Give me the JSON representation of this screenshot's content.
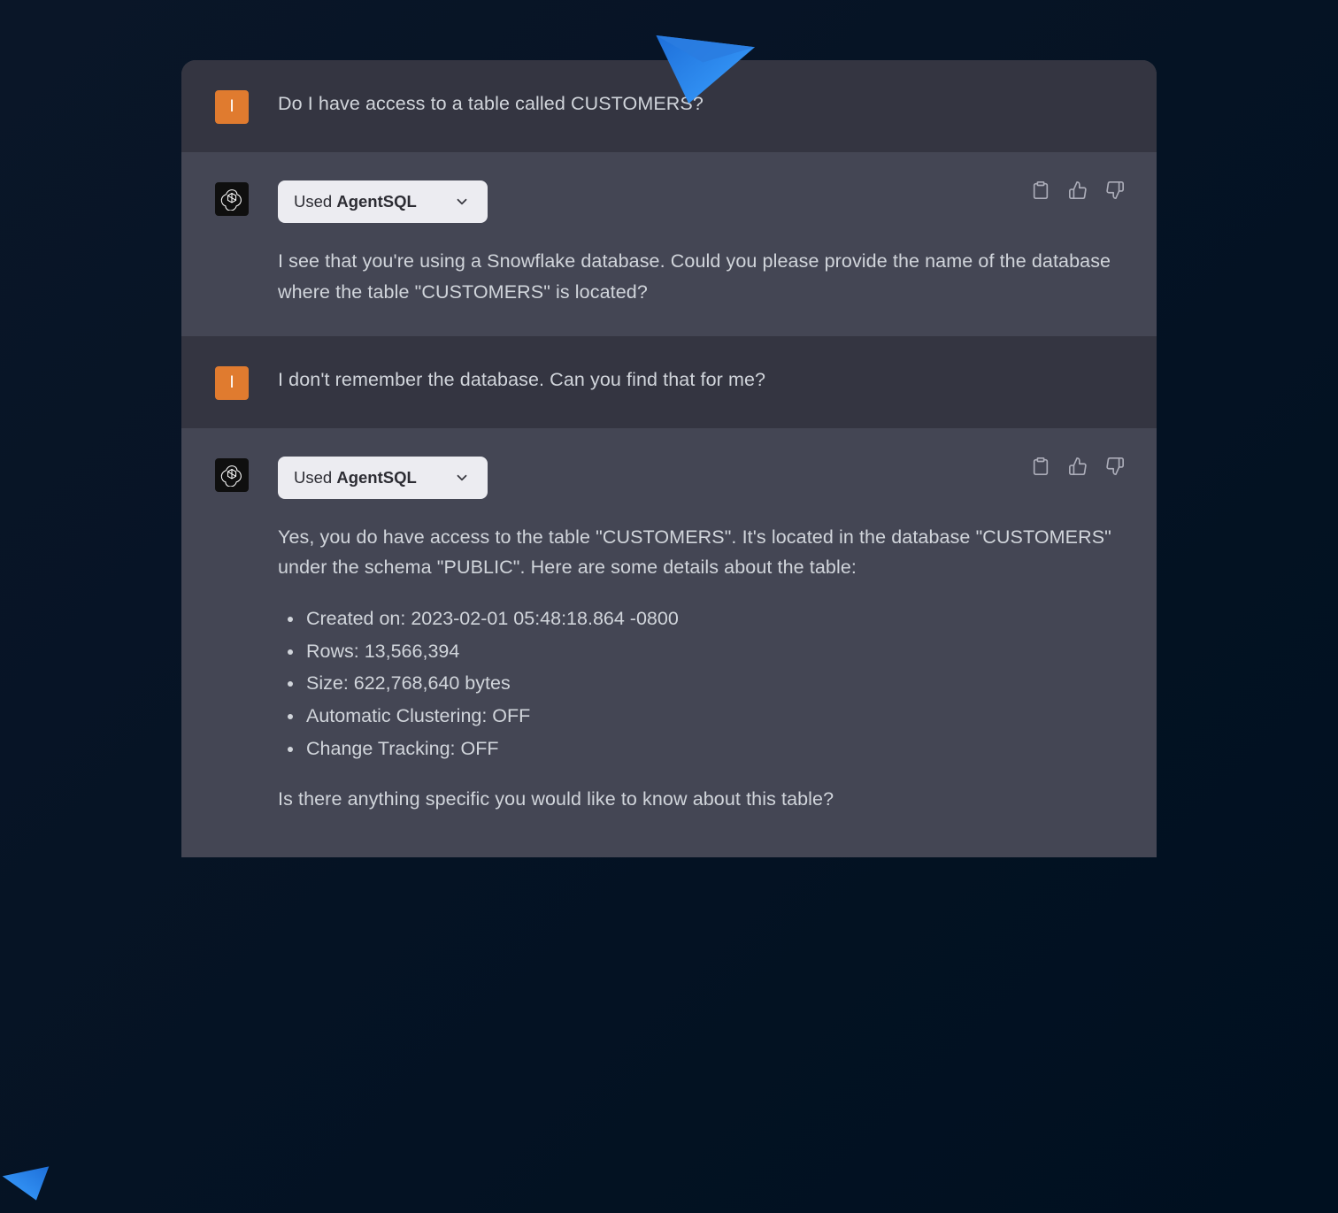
{
  "user_avatar_letter": "I",
  "messages": [
    {
      "role": "user",
      "text": "Do I have access to a table called CUSTOMERS?"
    },
    {
      "role": "assistant",
      "tool_prefix": "Used ",
      "tool_name": "AgentSQL",
      "text": "I see that you're using a Snowflake database. Could you please provide the name of the database where the table \"CUSTOMERS\" is located?"
    },
    {
      "role": "user",
      "text": "I don't remember the database. Can you find that for me?"
    },
    {
      "role": "assistant",
      "tool_prefix": "Used ",
      "tool_name": "AgentSQL",
      "text_before": "Yes, you do have access to the table \"CUSTOMERS\". It's located in the database \"CUSTOMERS\" under the schema \"PUBLIC\". Here are some details about the table:",
      "bullets": [
        "Created on: 2023-02-01 05:48:18.864 -0800",
        "Rows: 13,566,394",
        "Size: 622,768,640 bytes",
        "Automatic Clustering: OFF",
        "Change Tracking: OFF"
      ],
      "text_after": "Is there anything specific you would like to know about this table?"
    }
  ]
}
